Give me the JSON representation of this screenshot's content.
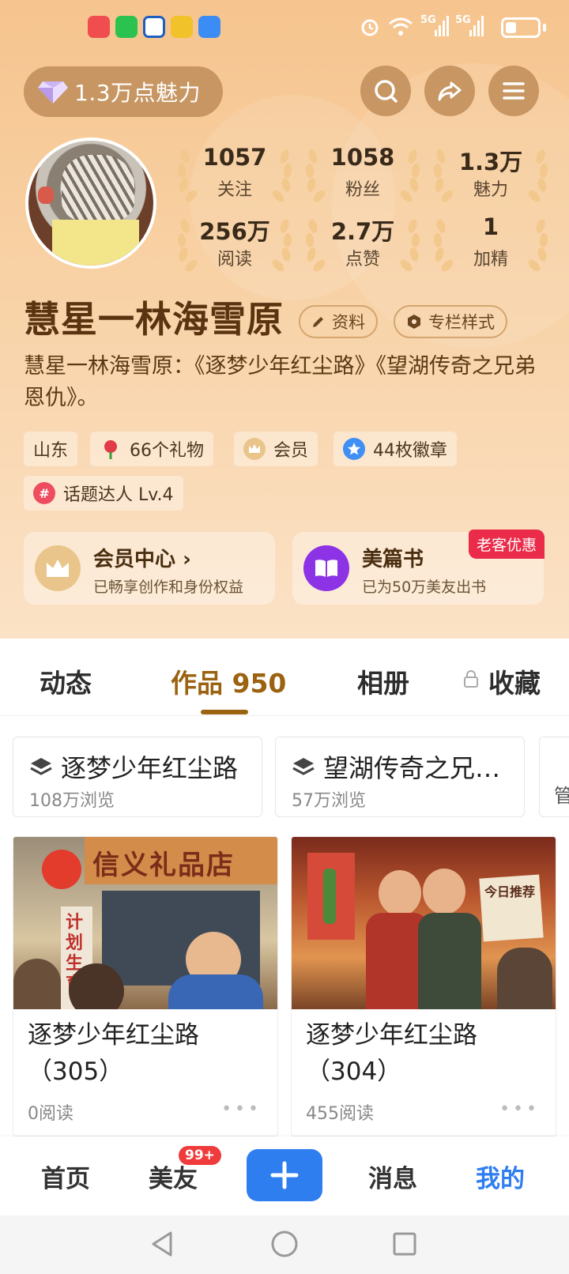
{
  "header": {
    "charm_pill": "1.3万点魅力"
  },
  "stats": [
    {
      "num": "1057",
      "label": "关注"
    },
    {
      "num": "1058",
      "label": "粉丝"
    },
    {
      "num": "1.3万",
      "label": "魅力"
    },
    {
      "num": "256万",
      "label": "阅读"
    },
    {
      "num": "2.7万",
      "label": "点赞"
    },
    {
      "num": "1",
      "label": "加精"
    }
  ],
  "profile": {
    "name": "慧星一林海雪原",
    "edit_label": "资料",
    "column_style_label": "专栏样式",
    "bio": "慧星一林海雪原：《逐梦少年红尘路》《望湖传奇之兄弟恩仇》。"
  },
  "tags": {
    "location": "山东",
    "gifts": "66个礼物",
    "member": "会员",
    "badges": "44枚徽章",
    "topic": "话题达人 Lv.4"
  },
  "cards": {
    "member_center": {
      "title": "会员中心",
      "arrow": "›",
      "sub": "已畅享创作和身份权益"
    },
    "book": {
      "title": "美篇书",
      "sub": "已为50万美友出书",
      "badge": "老客优惠"
    }
  },
  "tabs": {
    "feed": "动态",
    "works": "作品 950",
    "album": "相册",
    "favorites": "收藏"
  },
  "collections": [
    {
      "title": "逐梦少年红尘路",
      "views": "108万浏览"
    },
    {
      "title": "望湖传奇之兄…",
      "views": "57万浏览"
    },
    {
      "title": "管",
      "views": ""
    }
  ],
  "articles": [
    {
      "title": "逐梦少年红尘路（305）",
      "reads": "0阅读",
      "more": "•••",
      "sign1": "信义礼品店",
      "sign2": "计划生育"
    },
    {
      "title": "逐梦少年红尘路（304）",
      "reads": "455阅读",
      "more": "•••",
      "sign1": "今日推荐"
    }
  ],
  "bottom_nav": {
    "home": "首页",
    "friends": "美友",
    "friends_badge": "99+",
    "messages": "消息",
    "me": "我的"
  },
  "status_bar": {
    "net1": "5G",
    "net2": "5G"
  },
  "colors": {
    "accent_brown": "#9b6210",
    "brand_blue": "#2f7ef0",
    "badge_red": "#ea2c4a"
  }
}
